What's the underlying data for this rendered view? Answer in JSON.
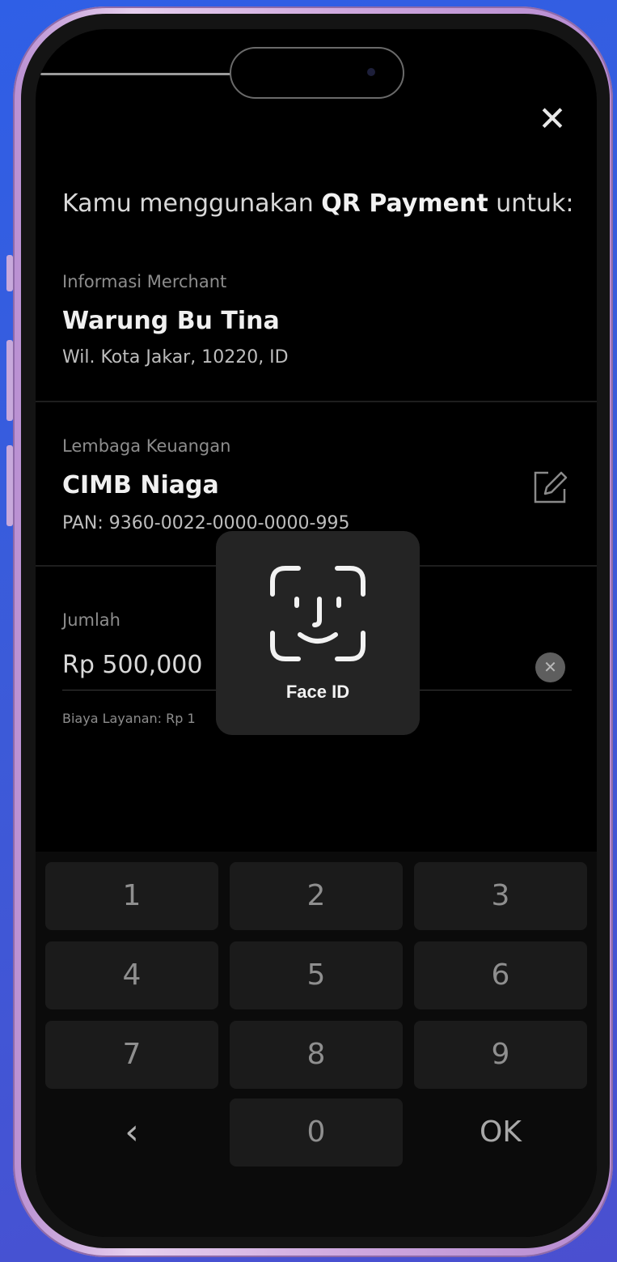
{
  "header": {
    "close_icon": "close-icon",
    "prefix": "Kamu menggunakan ",
    "highlight": "QR Payment",
    "suffix": " untuk:"
  },
  "merchant": {
    "label": "Informasi Merchant",
    "name": "Warung Bu Tina",
    "location": "Wil. Kota Jakar, 10220, ID"
  },
  "institution": {
    "label": "Lembaga Keuangan",
    "name": "CIMB Niaga",
    "pan": "PAN: 9360-0022-0000-0000-995",
    "edit_icon": "edit-icon"
  },
  "amount": {
    "label": "Jumlah",
    "value": "Rp 500,000",
    "clear_icon": "clear-icon",
    "fee_text": "Biaya Layanan: Rp 1"
  },
  "face_id": {
    "label": "Face ID",
    "icon": "face-id-icon"
  },
  "keypad": {
    "keys": [
      "1",
      "2",
      "3",
      "4",
      "5",
      "6",
      "7",
      "8",
      "9",
      "‹",
      "0",
      "OK"
    ]
  }
}
